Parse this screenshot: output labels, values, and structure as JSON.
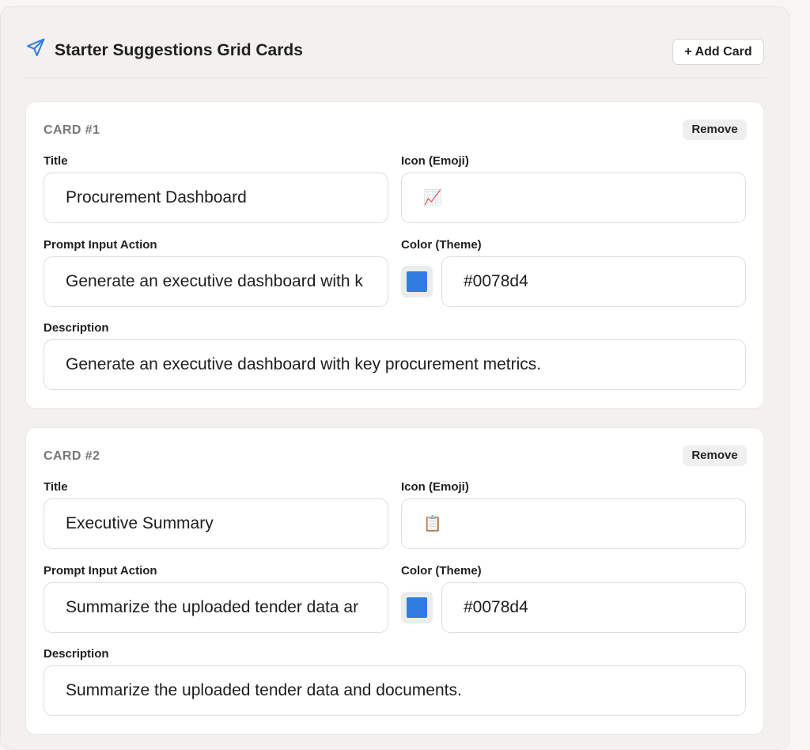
{
  "header": {
    "title": "Starter Suggestions Grid Cards",
    "icon": "paper-plane-icon",
    "add_button_label": "+ Add Card",
    "accent_color": "#2f7de1"
  },
  "labels": {
    "title": "Title",
    "icon": "Icon (Emoji)",
    "prompt": "Prompt Input Action",
    "color": "Color (Theme)",
    "description": "Description",
    "remove": "Remove"
  },
  "cards": [
    {
      "number_label": "CARD #1",
      "title": "Procurement Dashboard",
      "icon": "📈",
      "prompt": "Generate an executive dashboard with k",
      "color": "#0078d4",
      "swatch_color": "#2f7de1",
      "description": "Generate an executive dashboard with key procurement metrics."
    },
    {
      "number_label": "CARD #2",
      "title": "Executive Summary",
      "icon": "📋",
      "prompt": "Summarize the uploaded tender data ar",
      "color": "#0078d4",
      "swatch_color": "#2f7de1",
      "description": "Summarize the uploaded tender data and documents."
    }
  ]
}
